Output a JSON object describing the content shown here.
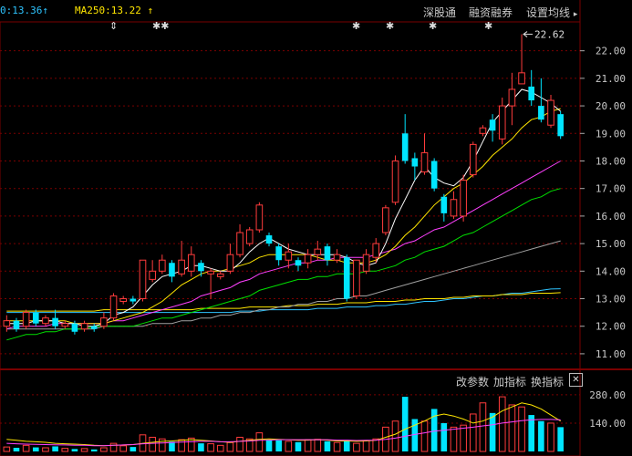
{
  "header": {
    "ma_left": {
      "label": "0:13.36",
      "arrow": "↑",
      "color": "#2ec4ff"
    },
    "ma250": {
      "label": "MA250:13.22",
      "arrow": "↑",
      "color": "#ffe600"
    }
  },
  "menu": {
    "shenzhen_connect": "深股通",
    "margin_trading": "融资融券",
    "set_ma": "设置均线"
  },
  "markers": [
    "⇕",
    "✱✱",
    "✱",
    "✱",
    "✱",
    "✱"
  ],
  "price_axis": {
    "ticks": [
      "22.00",
      "21.00",
      "20.00",
      "19.00",
      "18.00",
      "17.00",
      "16.00",
      "15.00",
      "14.00",
      "13.00",
      "12.00",
      "11.00"
    ]
  },
  "volume_axis": {
    "ticks": [
      "280.00",
      "140.00"
    ]
  },
  "high_label": "22.62",
  "volume_panel": {
    "params_btn": "改参数",
    "add_indicator": "加指标",
    "switch_indicator": "换指标",
    "close": "✕"
  },
  "colors": {
    "up": "#ff3c3c",
    "down": "#00e5ff",
    "ma5": "#ffffff",
    "ma10": "#ffe600",
    "ma20": "#ff40ff",
    "ma30": "#00e000",
    "ma60": "#a0a0a0",
    "ma120": "#2ec4ff",
    "ma250": "#ffe600",
    "grid": "#7a0000"
  },
  "chart_data": {
    "type": "candlestick",
    "ylim": [
      10.6,
      22.85
    ],
    "candles": [
      {
        "o": 12.0,
        "c": 12.2,
        "h": 12.4,
        "l": 11.8
      },
      {
        "o": 12.2,
        "c": 11.9,
        "h": 12.3,
        "l": 11.8
      },
      {
        "o": 12.0,
        "c": 12.5,
        "h": 12.6,
        "l": 11.9
      },
      {
        "o": 12.5,
        "c": 12.1,
        "h": 12.6,
        "l": 12.0
      },
      {
        "o": 12.1,
        "c": 12.3,
        "h": 12.4,
        "l": 12.0
      },
      {
        "o": 12.3,
        "c": 12.0,
        "h": 12.6,
        "l": 11.9
      },
      {
        "o": 12.0,
        "c": 12.1,
        "h": 12.2,
        "l": 11.9
      },
      {
        "o": 12.1,
        "c": 11.8,
        "h": 12.2,
        "l": 11.7
      },
      {
        "o": 11.9,
        "c": 12.1,
        "h": 12.2,
        "l": 11.8
      },
      {
        "o": 12.0,
        "c": 11.9,
        "h": 12.1,
        "l": 11.8
      },
      {
        "o": 12.0,
        "c": 12.3,
        "h": 12.5,
        "l": 11.9
      },
      {
        "o": 12.3,
        "c": 13.1,
        "h": 13.2,
        "l": 12.2
      },
      {
        "o": 12.9,
        "c": 13.0,
        "h": 13.1,
        "l": 12.8
      },
      {
        "o": 13.0,
        "c": 12.9,
        "h": 13.1,
        "l": 12.8
      },
      {
        "o": 13.0,
        "c": 14.4,
        "h": 14.4,
        "l": 12.9
      },
      {
        "o": 13.7,
        "c": 14.0,
        "h": 14.4,
        "l": 13.6
      },
      {
        "o": 14.0,
        "c": 14.4,
        "h": 14.6,
        "l": 13.9
      },
      {
        "o": 14.3,
        "c": 13.8,
        "h": 14.4,
        "l": 13.6
      },
      {
        "o": 13.9,
        "c": 14.4,
        "h": 15.1,
        "l": 13.8
      },
      {
        "o": 14.0,
        "c": 14.6,
        "h": 14.9,
        "l": 13.8
      },
      {
        "o": 14.3,
        "c": 14.0,
        "h": 14.4,
        "l": 13.8
      },
      {
        "o": 13.9,
        "c": 14.0,
        "h": 14.1,
        "l": 13.0
      },
      {
        "o": 13.8,
        "c": 13.9,
        "h": 14.0,
        "l": 13.7
      },
      {
        "o": 14.0,
        "c": 14.6,
        "h": 15.0,
        "l": 13.9
      },
      {
        "o": 14.6,
        "c": 15.4,
        "h": 15.7,
        "l": 14.5
      },
      {
        "o": 15.0,
        "c": 15.5,
        "h": 15.6,
        "l": 14.9
      },
      {
        "o": 15.5,
        "c": 16.4,
        "h": 16.5,
        "l": 15.4
      },
      {
        "o": 15.3,
        "c": 15.0,
        "h": 15.4,
        "l": 14.9
      },
      {
        "o": 14.9,
        "c": 14.4,
        "h": 15.0,
        "l": 14.2
      },
      {
        "o": 14.4,
        "c": 14.7,
        "h": 15.0,
        "l": 14.1
      },
      {
        "o": 14.4,
        "c": 14.2,
        "h": 14.5,
        "l": 14.0
      },
      {
        "o": 14.3,
        "c": 14.6,
        "h": 14.8,
        "l": 14.1
      },
      {
        "o": 14.6,
        "c": 14.8,
        "h": 15.1,
        "l": 14.4
      },
      {
        "o": 14.9,
        "c": 14.4,
        "h": 15.0,
        "l": 14.2
      },
      {
        "o": 14.4,
        "c": 14.6,
        "h": 14.8,
        "l": 14.3
      },
      {
        "o": 14.5,
        "c": 13.0,
        "h": 14.6,
        "l": 12.9
      },
      {
        "o": 13.1,
        "c": 14.4,
        "h": 14.4,
        "l": 13.0
      },
      {
        "o": 14.0,
        "c": 14.6,
        "h": 14.8,
        "l": 13.9
      },
      {
        "o": 14.5,
        "c": 15.0,
        "h": 15.2,
        "l": 14.3
      },
      {
        "o": 15.4,
        "c": 16.3,
        "h": 16.4,
        "l": 15.3
      },
      {
        "o": 16.5,
        "c": 18.0,
        "h": 18.2,
        "l": 16.4
      },
      {
        "o": 19.0,
        "c": 18.0,
        "h": 19.7,
        "l": 17.9
      },
      {
        "o": 18.1,
        "c": 17.8,
        "h": 18.3,
        "l": 17.3
      },
      {
        "o": 17.6,
        "c": 18.3,
        "h": 19.0,
        "l": 17.5
      },
      {
        "o": 18.0,
        "c": 17.0,
        "h": 18.1,
        "l": 16.9
      },
      {
        "o": 16.7,
        "c": 16.1,
        "h": 16.8,
        "l": 15.8
      },
      {
        "o": 16.0,
        "c": 16.6,
        "h": 16.9,
        "l": 15.9
      },
      {
        "o": 16.0,
        "c": 17.3,
        "h": 17.5,
        "l": 15.8
      },
      {
        "o": 17.5,
        "c": 18.6,
        "h": 18.7,
        "l": 17.4
      },
      {
        "o": 19.0,
        "c": 19.2,
        "h": 19.3,
        "l": 18.9
      },
      {
        "o": 19.5,
        "c": 19.1,
        "h": 19.7,
        "l": 18.7
      },
      {
        "o": 18.8,
        "c": 20.0,
        "h": 20.3,
        "l": 18.6
      },
      {
        "o": 20.0,
        "c": 20.6,
        "h": 21.2,
        "l": 19.3
      },
      {
        "o": 20.8,
        "c": 21.2,
        "h": 22.6,
        "l": 20.8
      },
      {
        "o": 20.7,
        "c": 20.2,
        "h": 21.3,
        "l": 20.0
      },
      {
        "o": 20.0,
        "c": 19.5,
        "h": 21.0,
        "l": 19.4
      },
      {
        "o": 19.3,
        "c": 20.2,
        "h": 20.4,
        "l": 19.2
      },
      {
        "o": 19.7,
        "c": 18.9,
        "h": 19.8,
        "l": 18.8
      }
    ],
    "ma5": [
      12.1,
      12.1,
      12.1,
      12.2,
      12.2,
      12.2,
      12.1,
      12.1,
      12.0,
      12.0,
      12.1,
      12.4,
      12.5,
      12.7,
      13.1,
      13.5,
      13.8,
      13.9,
      14.0,
      14.2,
      14.2,
      14.1,
      14.0,
      14.0,
      14.3,
      14.7,
      15.0,
      15.2,
      15.0,
      14.8,
      14.7,
      14.6,
      14.6,
      14.6,
      14.6,
      14.5,
      14.3,
      14.2,
      14.3,
      15.0,
      15.9,
      16.6,
      17.3,
      17.8,
      17.4,
      17.2,
      17.1,
      17.4,
      18.0,
      18.7,
      19.4,
      19.8,
      20.2,
      20.6,
      20.5,
      20.3,
      20.1,
      19.8
    ],
    "ma10": [
      12.2,
      12.2,
      12.2,
      12.2,
      12.2,
      12.2,
      12.2,
      12.1,
      12.1,
      12.1,
      12.1,
      12.2,
      12.3,
      12.4,
      12.5,
      12.7,
      12.9,
      13.2,
      13.5,
      13.7,
      13.9,
      14.0,
      14.0,
      14.1,
      14.2,
      14.3,
      14.5,
      14.6,
      14.6,
      14.6,
      14.6,
      14.6,
      14.5,
      14.4,
      14.4,
      14.3,
      14.3,
      14.3,
      14.4,
      14.6,
      14.9,
      15.3,
      15.6,
      16.0,
      16.4,
      16.7,
      17.0,
      17.2,
      17.5,
      17.8,
      18.2,
      18.5,
      18.8,
      19.2,
      19.5,
      19.6,
      19.8,
      19.9
    ],
    "ma20": [
      11.9,
      12.0,
      12.0,
      12.0,
      12.0,
      12.1,
      12.1,
      12.1,
      12.1,
      12.1,
      12.1,
      12.2,
      12.2,
      12.3,
      12.4,
      12.5,
      12.6,
      12.7,
      12.8,
      12.9,
      13.1,
      13.2,
      13.3,
      13.4,
      13.6,
      13.7,
      13.9,
      14.0,
      14.1,
      14.2,
      14.3,
      14.3,
      14.4,
      14.4,
      14.5,
      14.5,
      14.5,
      14.5,
      14.6,
      14.7,
      14.8,
      15.0,
      15.1,
      15.3,
      15.5,
      15.6,
      15.8,
      16.0,
      16.2,
      16.4,
      16.6,
      16.8,
      17.0,
      17.2,
      17.4,
      17.6,
      17.8,
      18.0
    ],
    "ma30": [
      11.5,
      11.6,
      11.7,
      11.7,
      11.8,
      11.8,
      11.9,
      11.9,
      11.9,
      12.0,
      12.0,
      12.0,
      12.0,
      12.0,
      12.1,
      12.2,
      12.3,
      12.3,
      12.4,
      12.5,
      12.6,
      12.7,
      12.8,
      12.9,
      13.0,
      13.1,
      13.3,
      13.4,
      13.5,
      13.6,
      13.7,
      13.7,
      13.8,
      13.8,
      13.9,
      13.9,
      13.9,
      14.0,
      14.0,
      14.1,
      14.2,
      14.4,
      14.5,
      14.7,
      14.8,
      14.9,
      15.1,
      15.3,
      15.4,
      15.6,
      15.8,
      16.0,
      16.2,
      16.4,
      16.6,
      16.7,
      16.9,
      17.0
    ],
    "ma60": [
      11.9,
      11.9,
      11.9,
      11.9,
      11.9,
      11.9,
      11.9,
      11.9,
      11.9,
      11.9,
      12.0,
      12.0,
      12.0,
      12.0,
      12.0,
      12.1,
      12.1,
      12.1,
      12.2,
      12.2,
      12.3,
      12.3,
      12.4,
      12.4,
      12.5,
      12.5,
      12.6,
      12.6,
      12.7,
      12.7,
      12.8,
      12.8,
      12.9,
      12.9,
      13.0,
      13.0,
      13.1,
      13.1,
      13.2,
      13.3,
      13.4,
      13.5,
      13.6,
      13.7,
      13.8,
      13.9,
      14.0,
      14.1,
      14.2,
      14.3,
      14.4,
      14.5,
      14.6,
      14.7,
      14.8,
      14.9,
      15.0,
      15.1
    ],
    "ma120": [
      12.5,
      12.5,
      12.5,
      12.5,
      12.5,
      12.5,
      12.5,
      12.5,
      12.5,
      12.5,
      12.5,
      12.5,
      12.5,
      12.5,
      12.5,
      12.5,
      12.5,
      12.5,
      12.5,
      12.5,
      12.5,
      12.5,
      12.5,
      12.5,
      12.55,
      12.55,
      12.55,
      12.6,
      12.6,
      12.6,
      12.6,
      12.6,
      12.65,
      12.65,
      12.65,
      12.7,
      12.7,
      12.7,
      12.75,
      12.75,
      12.8,
      12.8,
      12.85,
      12.9,
      12.9,
      12.95,
      13.0,
      13.0,
      13.05,
      13.1,
      13.1,
      13.15,
      13.2,
      13.2,
      13.25,
      13.3,
      13.35,
      13.36
    ],
    "ma250": [
      12.55,
      12.55,
      12.55,
      12.55,
      12.55,
      12.55,
      12.55,
      12.55,
      12.55,
      12.55,
      12.6,
      12.6,
      12.6,
      12.6,
      12.6,
      12.6,
      12.6,
      12.6,
      12.6,
      12.6,
      12.65,
      12.65,
      12.65,
      12.65,
      12.65,
      12.7,
      12.7,
      12.7,
      12.7,
      12.75,
      12.75,
      12.75,
      12.8,
      12.8,
      12.8,
      12.85,
      12.85,
      12.85,
      12.9,
      12.9,
      12.9,
      12.95,
      12.95,
      13.0,
      13.0,
      13.0,
      13.05,
      13.05,
      13.1,
      13.1,
      13.1,
      13.15,
      13.15,
      13.15,
      13.2,
      13.2,
      13.2,
      13.22
    ],
    "volume": [
      22,
      18,
      30,
      20,
      18,
      25,
      15,
      12,
      14,
      10,
      18,
      40,
      28,
      22,
      82,
      70,
      62,
      48,
      58,
      66,
      40,
      38,
      30,
      44,
      70,
      62,
      92,
      58,
      55,
      50,
      46,
      58,
      60,
      50,
      44,
      52,
      40,
      54,
      62,
      120,
      150,
      270,
      160,
      150,
      210,
      140,
      120,
      130,
      185,
      240,
      190,
      270,
      230,
      220,
      180,
      150,
      140,
      120
    ],
    "volume_ylim": [
      0,
      320
    ],
    "vol_ma": [
      60,
      55,
      50,
      48,
      45,
      40,
      38,
      36,
      34,
      30,
      28,
      30,
      32,
      34,
      40,
      45,
      50,
      52,
      55,
      58,
      55,
      52,
      48,
      45,
      50,
      55,
      60,
      62,
      60,
      58,
      55,
      56,
      58,
      56,
      52,
      52,
      50,
      52,
      55,
      70,
      85,
      110,
      130,
      150,
      175,
      185,
      175,
      160,
      140,
      150,
      170,
      200,
      220,
      240,
      230,
      210,
      180,
      150
    ],
    "vol_ma2": [
      40,
      38,
      36,
      35,
      34,
      33,
      32,
      30,
      30,
      28,
      28,
      30,
      32,
      34,
      38,
      40,
      42,
      44,
      46,
      48,
      50,
      50,
      48,
      48,
      50,
      52,
      55,
      56,
      58,
      58,
      58,
      58,
      58,
      58,
      56,
      56,
      54,
      55,
      56,
      60,
      66,
      75,
      84,
      92,
      100,
      105,
      110,
      115,
      120,
      126,
      132,
      140,
      146,
      152,
      156,
      158,
      158,
      156
    ]
  }
}
